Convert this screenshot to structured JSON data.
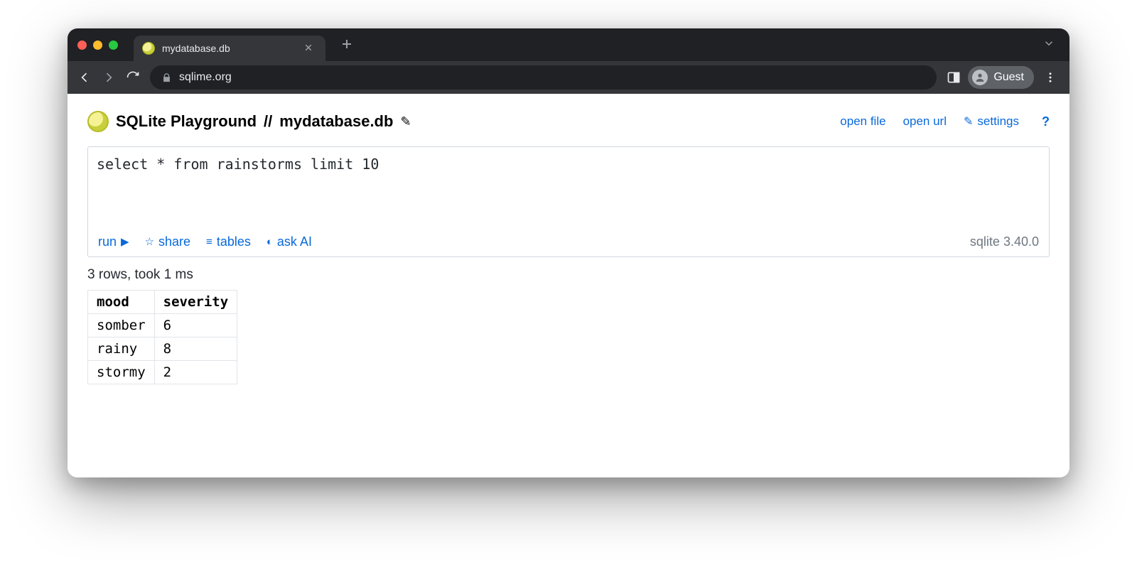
{
  "browser": {
    "tab_title": "mydatabase.db",
    "url": "sqlime.org",
    "profile_label": "Guest"
  },
  "header": {
    "app_title": "SQLite Playground",
    "separator": "//",
    "db_name": "mydatabase.db",
    "links": {
      "open_file": "open file",
      "open_url": "open url",
      "settings": "settings",
      "help": "?"
    }
  },
  "editor": {
    "query": "select * from rainstorms limit 10",
    "actions": {
      "run": "run",
      "share": "share",
      "tables": "tables",
      "ask_ai": "ask AI"
    },
    "sqlite_version": "sqlite 3.40.0"
  },
  "results": {
    "status": "3 rows, took 1 ms",
    "columns": [
      "mood",
      "severity"
    ],
    "rows": [
      {
        "mood": "somber",
        "severity": "6"
      },
      {
        "mood": "rainy",
        "severity": "8"
      },
      {
        "mood": "stormy",
        "severity": "2"
      }
    ]
  }
}
